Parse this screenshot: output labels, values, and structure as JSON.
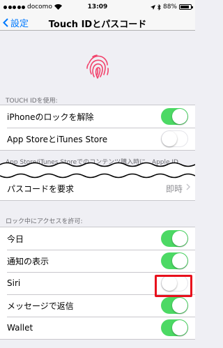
{
  "status_bar": {
    "carrier": "docomo",
    "time": "13:09",
    "battery": "88%",
    "battery_level": 0.88
  },
  "nav": {
    "back_label": "設定",
    "title": "Touch IDとパスコード"
  },
  "touch_id_section": {
    "header": "TOUCH IDを使用:",
    "rows": [
      {
        "label": "iPhoneのロックを解除",
        "on": true
      },
      {
        "label": "App StoreとiTunes Store",
        "on": false
      }
    ]
  },
  "footer_text": "App Store/iTunes Storeでのコンテンツ購入時に、Apple ID",
  "passcode_row": {
    "label": "パスコードを要求",
    "value": "即時"
  },
  "lock_access_section": {
    "header": "ロック中にアクセスを許可:",
    "rows": [
      {
        "label": "今日",
        "on": true
      },
      {
        "label": "通知の表示",
        "on": true
      },
      {
        "label": "Siri",
        "on": false
      },
      {
        "label": "メッセージで返信",
        "on": true
      },
      {
        "label": "Wallet",
        "on": true
      }
    ]
  },
  "colors": {
    "accent": "#007aff",
    "toggle_on": "#4cd964",
    "fingerprint": "#f2426b",
    "highlight": "#e8101c"
  }
}
